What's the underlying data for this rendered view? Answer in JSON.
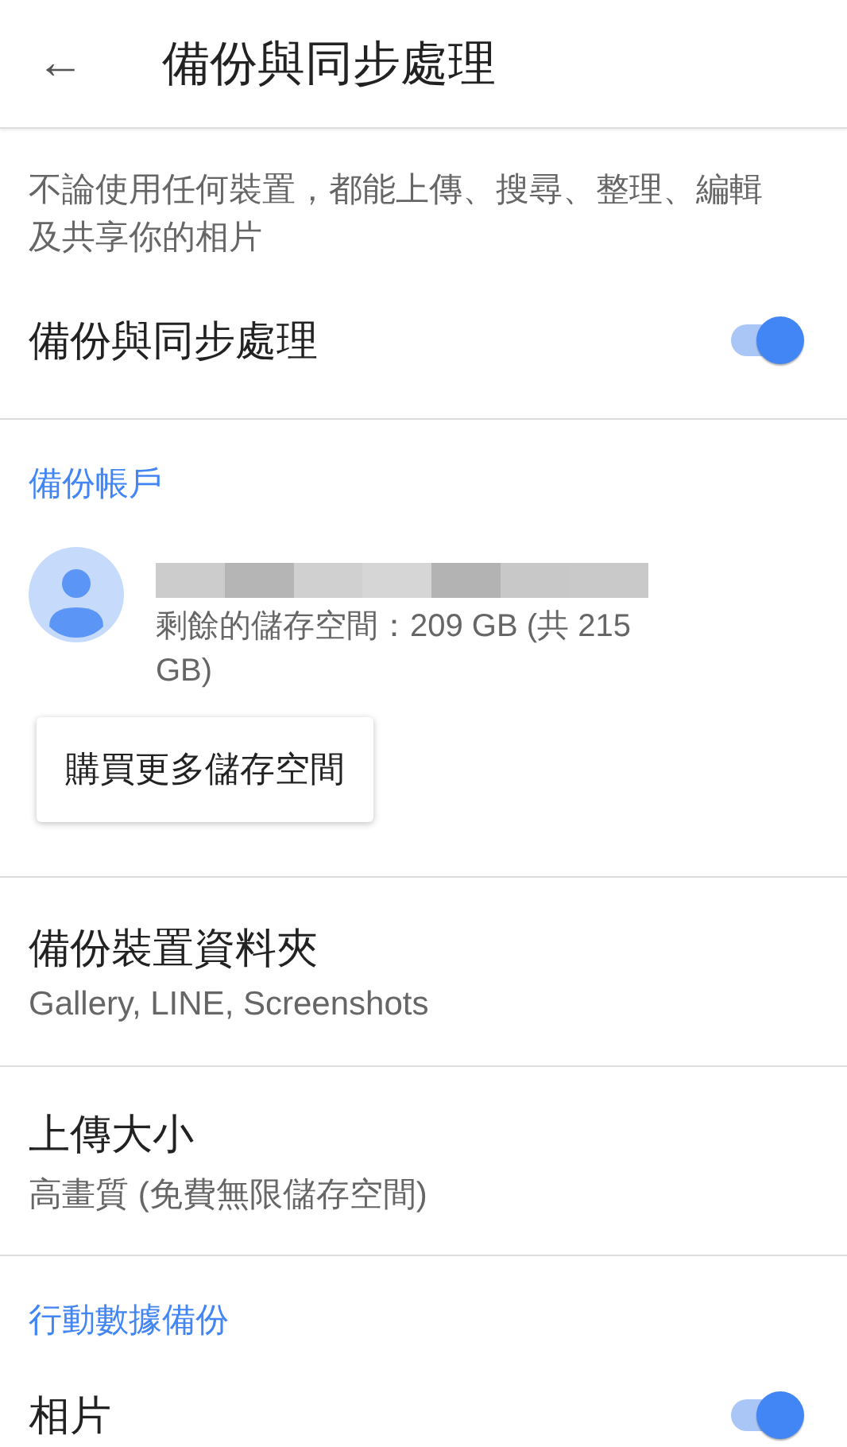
{
  "header": {
    "back_icon": "←",
    "title": "備份與同步處理"
  },
  "description": "不論使用任何裝置，都能上傳、搜尋、整理、編輯及共享你的相片",
  "main_toggle": {
    "label": "備份與同步處理",
    "on": true
  },
  "account_section": {
    "heading": "備份帳戶",
    "storage": "剩餘的儲存空間：209 GB (共 215 GB)",
    "buy_button": "購買更多儲存空間"
  },
  "settings": [
    {
      "title": "備份裝置資料夾",
      "subtitle": "Gallery, LINE, Screenshots"
    },
    {
      "title": "上傳大小",
      "subtitle": "高畫質 (免費無限儲存空間)"
    }
  ],
  "mobile_section": {
    "heading": "行動數據備份",
    "items": [
      {
        "label": "相片",
        "on": true
      }
    ]
  }
}
